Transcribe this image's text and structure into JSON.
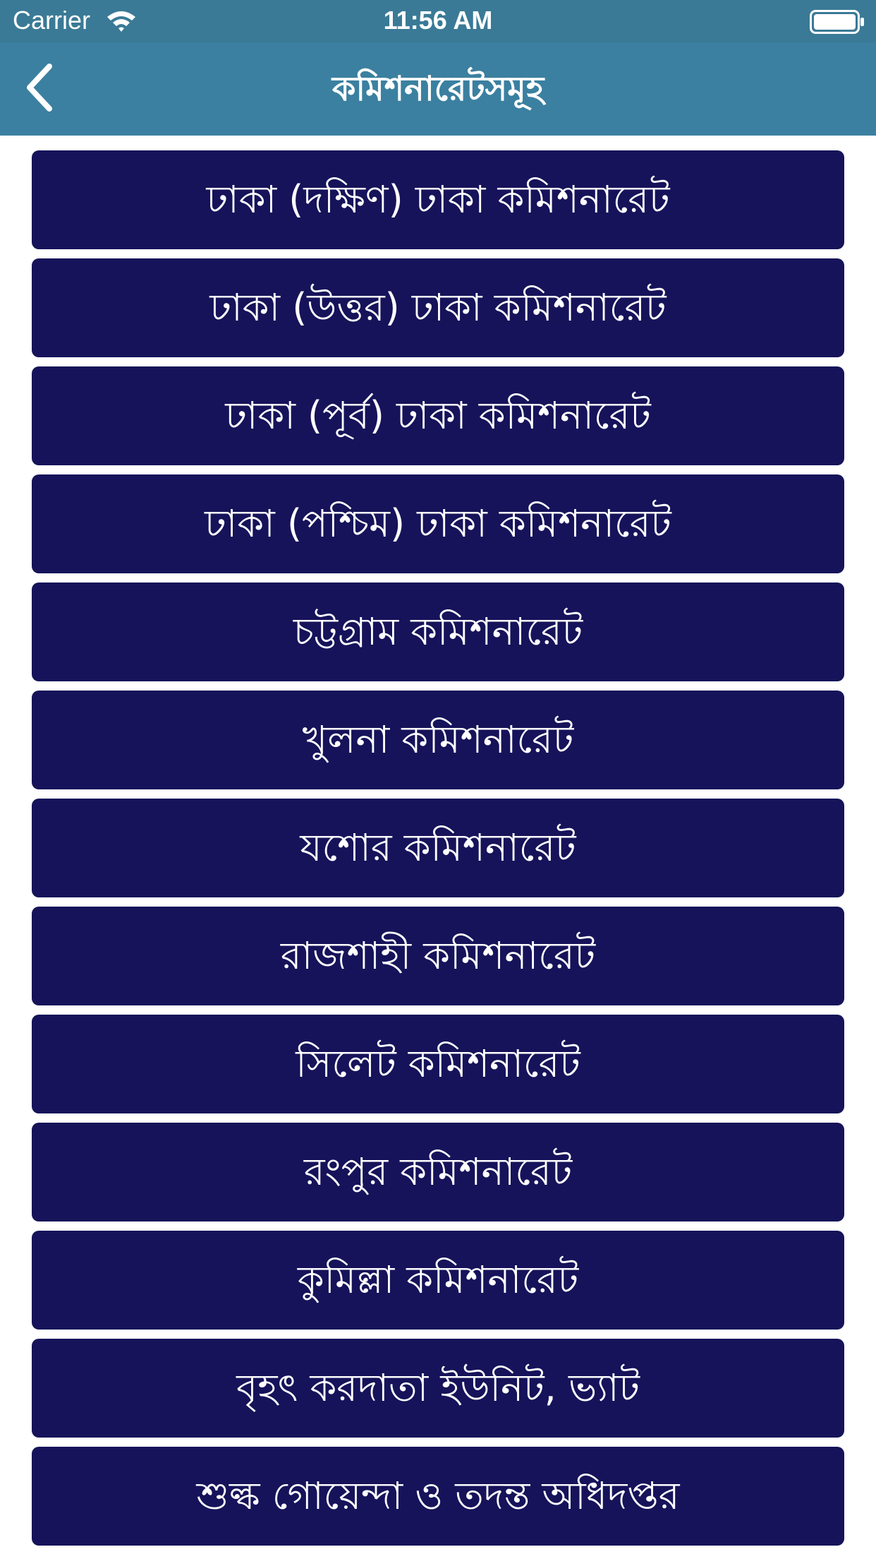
{
  "status_bar": {
    "carrier": "Carrier",
    "time": "11:56 AM",
    "wifi_icon": "wifi-icon",
    "battery_icon": "battery-full-icon"
  },
  "nav": {
    "title": "কমিশনারেটসমূহ",
    "back_icon": "chevron-left-icon",
    "background_color": "#3b80a0"
  },
  "list": {
    "button_color": "#16135a",
    "items": [
      {
        "label": "ঢাকা (দক্ষিণ) ঢাকা কমিশনারেট"
      },
      {
        "label": "ঢাকা (উত্তর) ঢাকা কমিশনারেট"
      },
      {
        "label": "ঢাকা (পূর্ব) ঢাকা কমিশনারেট"
      },
      {
        "label": "ঢাকা (পশ্চিম) ঢাকা কমিশনারেট"
      },
      {
        "label": "চট্টগ্রাম কমিশনারেট"
      },
      {
        "label": "খুলনা কমিশনারেট"
      },
      {
        "label": "যশোর কমিশনারেট"
      },
      {
        "label": "রাজশাহী কমিশনারেট"
      },
      {
        "label": "সিলেট কমিশনারেট"
      },
      {
        "label": "রংপুর কমিশনারেট"
      },
      {
        "label": "কুমিল্লা কমিশনারেট"
      },
      {
        "label": "বৃহৎ করদাতা ইউনিট, ভ্যাট"
      },
      {
        "label": "শুল্ক গোয়েন্দা ও তদন্ত অধিদপ্তর"
      }
    ]
  }
}
